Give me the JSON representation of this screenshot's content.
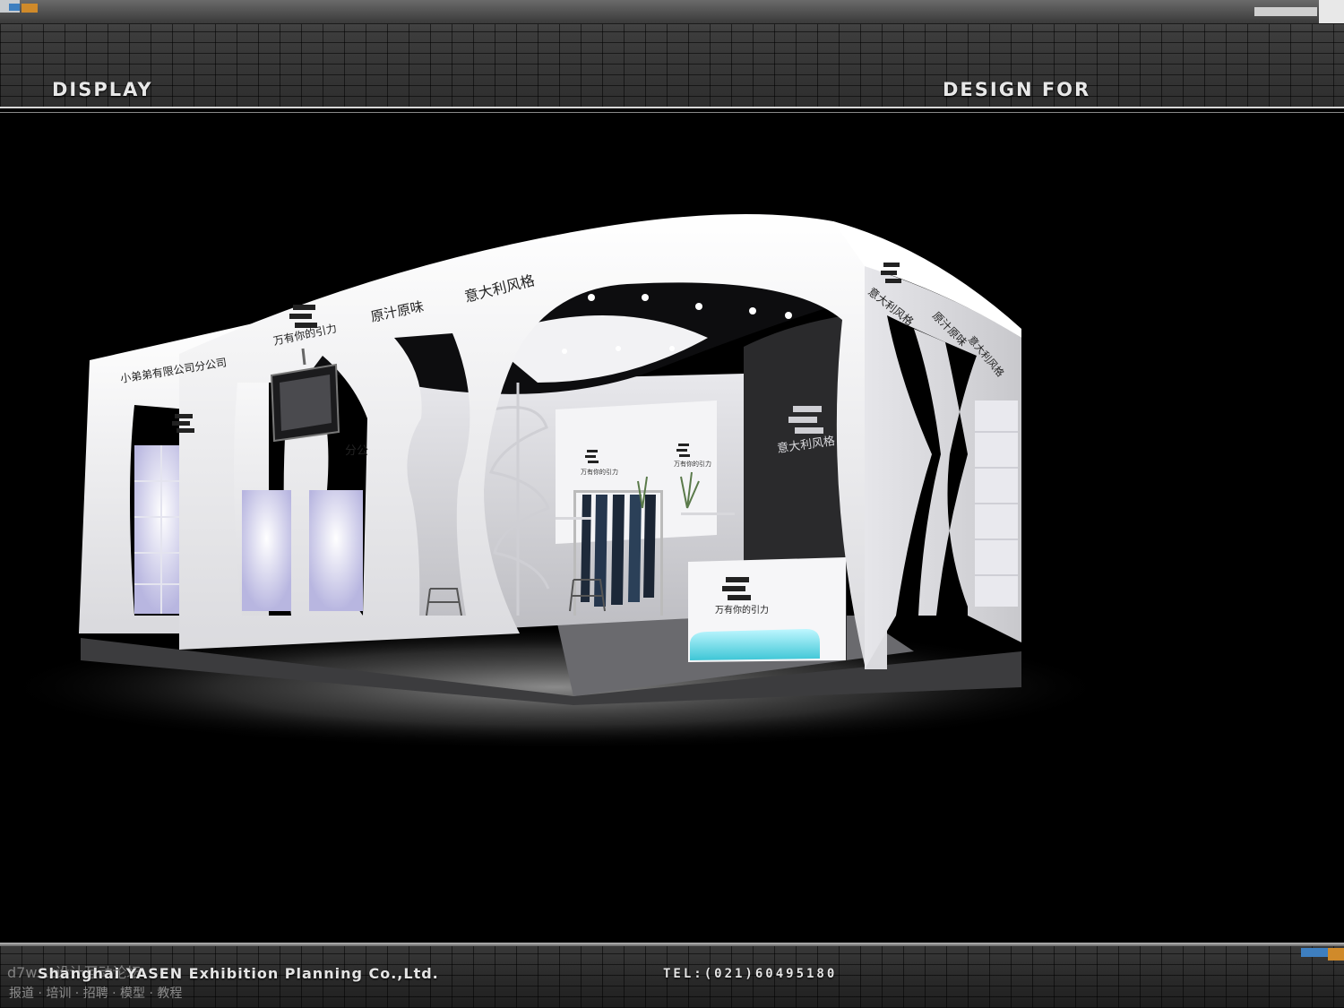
{
  "header": {
    "left_label": "DISPLAY",
    "right_label": "DESIGN FOR"
  },
  "booth_signage": {
    "brand_logo": "S-logo",
    "company_name": "小弟弟有限公司分公司",
    "slogan_gravity": "万有你的引力",
    "slogan_original": "原汁原味",
    "slogan_italian": "意大利风格",
    "side_panel_fragment": "分公",
    "back_wall_text": "意大利风格",
    "counter_text": "万有你的引力"
  },
  "footer": {
    "company": "Shanghai YASEN Exhibition Planning Co.,Ltd.",
    "tel": "TEL:(021)60495180",
    "watermark_line1": "d7w...t设计互动论坛",
    "watermark_line2": "报道 · 培训 · 招聘 · 模型 · 教程"
  },
  "colors": {
    "booth_white": "#f2f2f4",
    "back_wall_dark": "#2a2a2a",
    "counter_glow": "#6ee6f0",
    "header_text": "#e8e8e8"
  }
}
